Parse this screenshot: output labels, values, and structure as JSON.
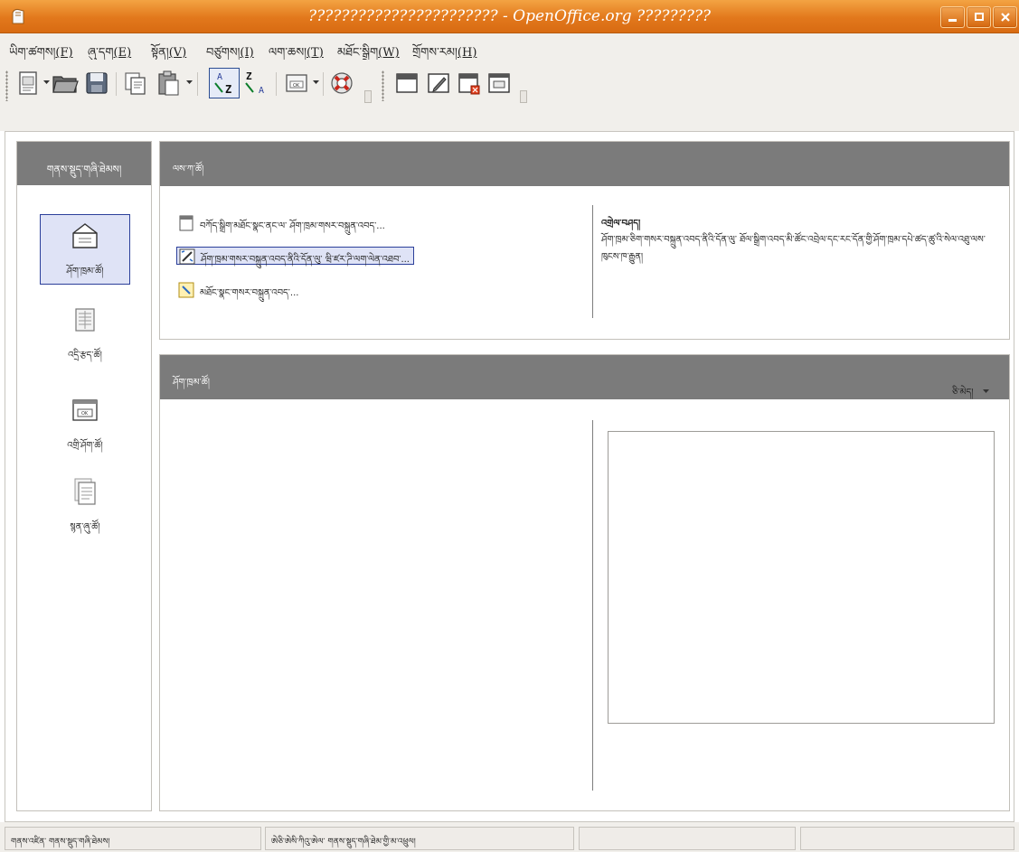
{
  "window": {
    "title": "??????????????????????? - OpenOffice.org ?????????",
    "buttons": [
      "minimize",
      "maximize",
      "close"
    ]
  },
  "menu": [
    {
      "label": "ཡིག་ཚགས།",
      "key": "(F)"
    },
    {
      "label": "ཞུ་དག",
      "key": "(E)"
    },
    {
      "label": "སྟོན།",
      "key": "(V)"
    },
    {
      "label": "བཙུགས།",
      "key": "(I)"
    },
    {
      "label": "ལག་ཆས།",
      "key": "(T)"
    },
    {
      "label": "མཐོང་སྒྲིག",
      "key": "(W)"
    },
    {
      "label": "གྲོགས་རམ།",
      "key": "(H)"
    }
  ],
  "toolbar": {
    "icons": [
      "new-document-icon",
      "open-folder-icon",
      "save-icon",
      "copy-icon",
      "paste-icon",
      "sort-ascending-icon",
      "sort-descending-icon",
      "form-button-icon",
      "help-lifebuoy-icon",
      "table-icon",
      "edit-form-icon",
      "delete-record-icon",
      "text-field-icon"
    ]
  },
  "sidebar": {
    "header": "གནས་སྡུད་གཞི་ཐེམས།",
    "items": [
      {
        "label": "ཤོག་ཁྲམ་ཚོ།",
        "icon": "table-icon",
        "selected": true
      },
      {
        "label": "འདྲི་རྩད་ཚོ།",
        "icon": "query-icon",
        "selected": false
      },
      {
        "label": "འགྲི་ཤོག་ཚོ།",
        "icon": "form-icon",
        "selected": false
      },
      {
        "label": "སྙན་ཞུ་ཚོ།",
        "icon": "report-icon",
        "selected": false
      }
    ]
  },
  "tasks_panel": {
    "header": "ལས་ཀ་ཚོ།",
    "tasks": [
      {
        "label": "བཀོད་སྒྲིག་མཐོང་སྣང་ནང་ལ་ ཤོག་ཁྲམ་གསར་བསྐྲུན་འབད་...",
        "icon": "design-view-icon",
        "selected": false
      },
      {
        "label": "ཤོག་ཁྲམ་གསར་བསྐྲུན་འབད་ནིའི་དོན་ལུ་ ཝི་ཛར་ཌི་ལག་ལེན་འཐབ་...",
        "icon": "wizard-icon",
        "selected": true
      },
      {
        "label": "མཐོང་སྣང་གསར་བསྐྲུན་འབད་...",
        "icon": "view-icon",
        "selected": false
      }
    ],
    "description_title": "འགྲེལ་བཤད།",
    "description": "ཤོག་ཁྲམ་ཅིག་གསར་བསྐྲུན་འབད་ནིའི་དོན་ལུ་ ཐོལ་སྒྲིག་འབད་མི་ཚོང་འབྲེལ་དང་རང་དོན་གྱི་ཤོག་ཁྲམ་དཔེ་ཚད་ཚུ་འི་སེལ་འཐུ་ལས་ ཁུངས་ཁ་རྒྱུན།"
  },
  "tables_panel": {
    "header": "ཤོག་ཁྲམ་ཚོ།",
    "preview_dropdown": "ཅི་མེད།"
  },
  "statusbar": {
    "cells": [
      "གནས་འཛིན་ གནས་སྡུད་གཞི་ཐེམས།",
      "ཨེཅི་ཨེསི་ཀིའུ་ཨེལ་ གནས་སྡུད་གཞི་ཐེམ་གྱི་མ་འཕྲུལ།",
      "",
      ""
    ]
  }
}
